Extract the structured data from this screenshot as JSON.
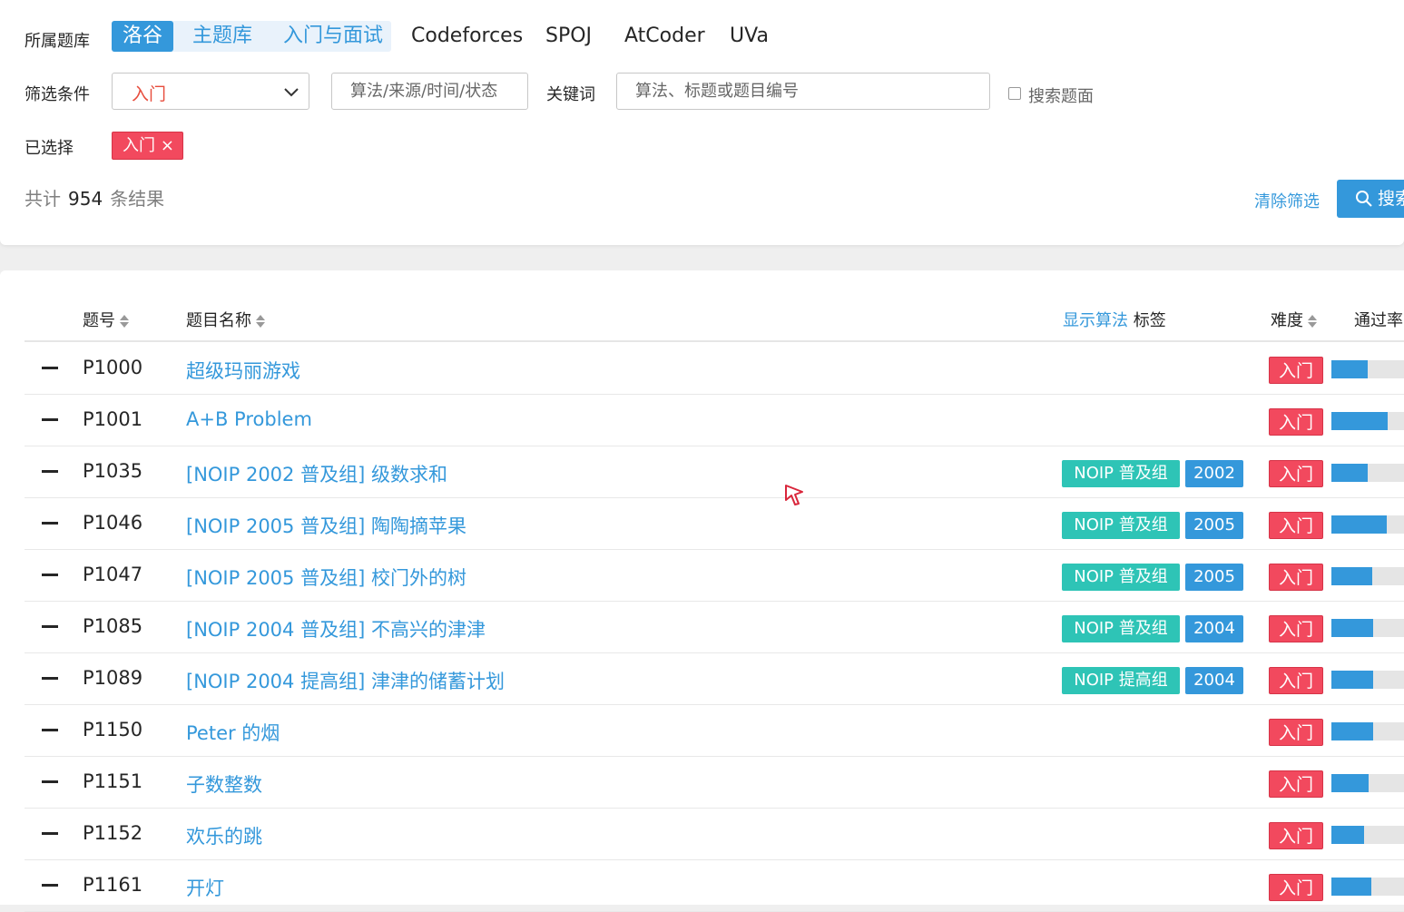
{
  "filters": {
    "bank_label": "所属题库",
    "banks": [
      {
        "label": "洛谷",
        "active": true
      },
      {
        "label": "主题库",
        "active": false
      },
      {
        "label": "入门与面试",
        "active": false
      },
      {
        "label": "Codeforces",
        "active": false
      },
      {
        "label": "SPOJ",
        "active": false
      },
      {
        "label": "AtCoder",
        "active": false
      },
      {
        "label": "UVa",
        "active": false
      }
    ],
    "condition_label": "筛选条件",
    "difficulty_value": "入门",
    "algorithm_placeholder": "算法/来源/时间/状态",
    "keyword_label": "关键词",
    "keyword_placeholder": "算法、标题或题目编号",
    "search_content_label": "搜索题面",
    "selected_label": "已选择",
    "selected_chip": "入门",
    "count_prefix": "共计",
    "count_value": "954",
    "count_suffix": "条结果",
    "clear_label": "清除筛选",
    "search_label": "搜索"
  },
  "table": {
    "headers": {
      "pid": "题号",
      "title": "题目名称",
      "show_algo": "显示算法",
      "tags": "标签",
      "difficulty": "难度",
      "pass_rate": "通过率"
    },
    "rows": [
      {
        "pid": "P1000",
        "title": "超级玛丽游戏",
        "tags": [],
        "difficulty": "入门",
        "pass": 0.4
      },
      {
        "pid": "P1001",
        "title": "A+B Problem",
        "tags": [],
        "difficulty": "入门",
        "pass": 0.62
      },
      {
        "pid": "P1035",
        "title": "[NOIP 2002 普及组] 级数求和",
        "tags": [
          "NOIP 普及组",
          "2002"
        ],
        "difficulty": "入门",
        "pass": 0.4
      },
      {
        "pid": "P1046",
        "title": "[NOIP 2005 普及组] 陶陶摘苹果",
        "tags": [
          "NOIP 普及组",
          "2005"
        ],
        "difficulty": "入门",
        "pass": 0.61
      },
      {
        "pid": "P1047",
        "title": "[NOIP 2005 普及组] 校门外的树",
        "tags": [
          "NOIP 普及组",
          "2005"
        ],
        "difficulty": "入门",
        "pass": 0.45
      },
      {
        "pid": "P1085",
        "title": "[NOIP 2004 普及组] 不高兴的津津",
        "tags": [
          "NOIP 普及组",
          "2004"
        ],
        "difficulty": "入门",
        "pass": 0.46
      },
      {
        "pid": "P1089",
        "title": "[NOIP 2004 提高组] 津津的储蓄计划",
        "tags": [
          "NOIP 提高组",
          "2004"
        ],
        "difficulty": "入门",
        "pass": 0.46
      },
      {
        "pid": "P1150",
        "title": "Peter 的烟",
        "tags": [],
        "difficulty": "入门",
        "pass": 0.46
      },
      {
        "pid": "P1151",
        "title": "子数整数",
        "tags": [],
        "difficulty": "入门",
        "pass": 0.41
      },
      {
        "pid": "P1152",
        "title": "欢乐的跳",
        "tags": [],
        "difficulty": "入门",
        "pass": 0.36
      },
      {
        "pid": "P1161",
        "title": "开灯",
        "tags": [],
        "difficulty": "入门",
        "pass": 0.44
      }
    ]
  },
  "colors": {
    "accent": "#3498db",
    "difficulty_red": "#f2495e",
    "tag_green": "#2ec4b6"
  }
}
